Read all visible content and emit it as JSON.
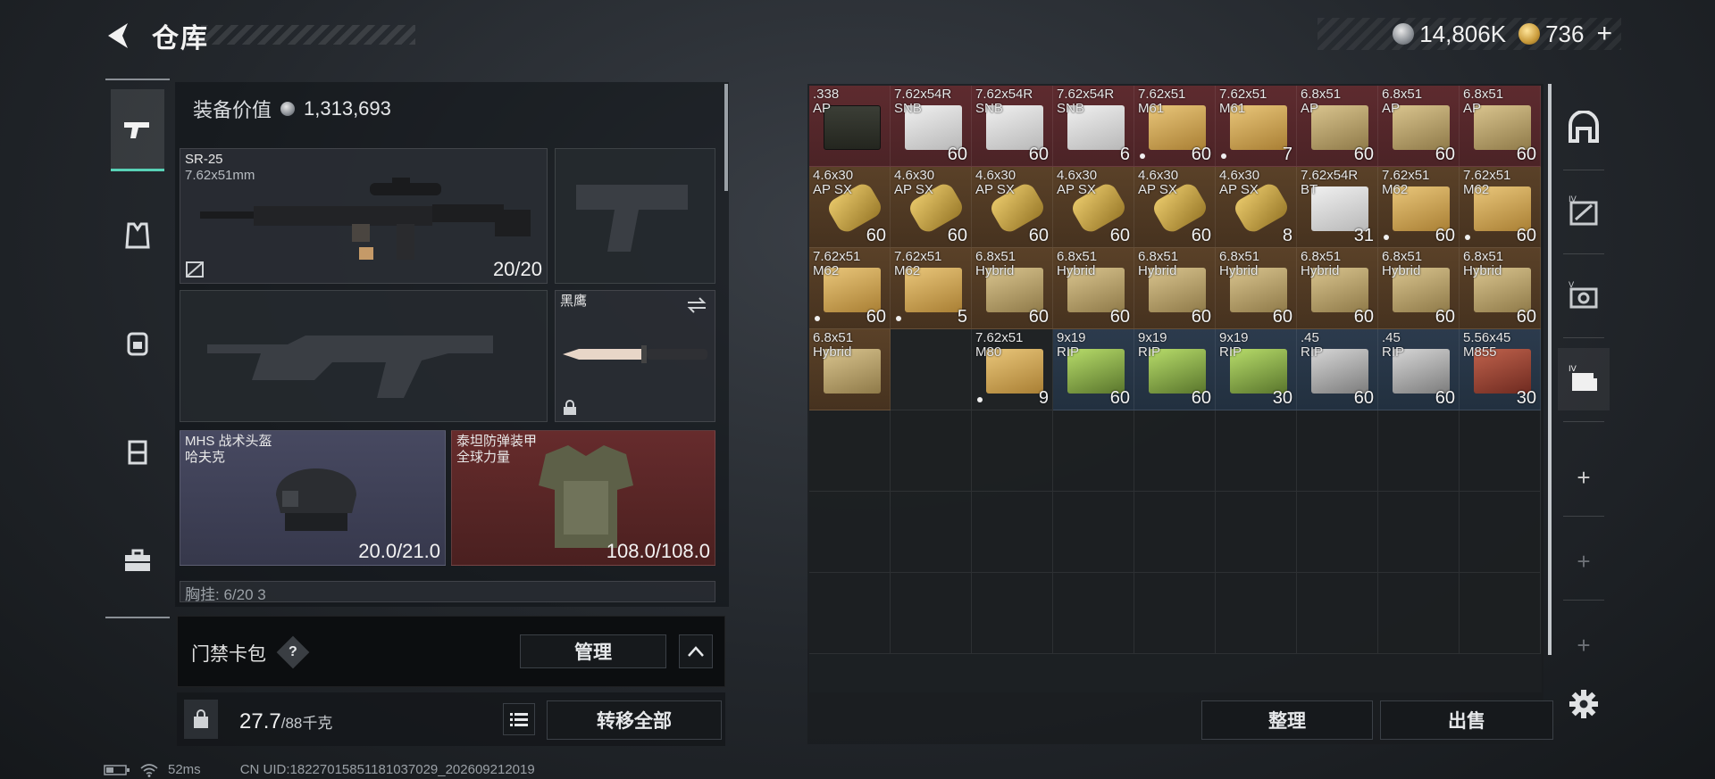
{
  "header": {
    "title": "仓库",
    "currency_silver": "14,806K",
    "currency_gold": "736",
    "add_label": "+"
  },
  "left_nav": {
    "items": [
      "gun-icon",
      "armor-vest-icon",
      "backpack-icon",
      "chest-rig-icon",
      "briefcase-icon"
    ]
  },
  "equipment": {
    "value_label": "装备价值",
    "value": "1,313,693",
    "primary": {
      "name": "SR-25",
      "caliber": "7.62x51mm",
      "count": "20/20"
    },
    "sidearm_knife": {
      "name": "黑鹰"
    },
    "helmet": {
      "name": "MHS 战术头盔",
      "sub": "哈夫克",
      "durability": "20.0/21.0"
    },
    "armor": {
      "name": "泰坦防弹装甲",
      "sub": "全球力量",
      "durability": "108.0/108.0"
    },
    "rig_partial": "胸挂: 6/20  3"
  },
  "keycard": {
    "label": "门禁卡包",
    "help": "?",
    "manage": "管理"
  },
  "weight": {
    "value": "27.7",
    "max": "/88千克"
  },
  "actions": {
    "transfer_all": "转移全部",
    "sort": "整理",
    "sell": "出售"
  },
  "status": {
    "ping": "52ms",
    "uid": "CN UID:18227015851181037029_202609212019"
  },
  "inventory": [
    {
      "name": ".338\nAP",
      "qty": "",
      "bg": "red",
      "box": "ammo-can",
      "dot": false
    },
    {
      "name": "7.62x54R\nSNB",
      "qty": "60",
      "bg": "red",
      "box": "white",
      "dot": false
    },
    {
      "name": "7.62x54R\nSNB",
      "qty": "60",
      "bg": "red",
      "box": "white",
      "dot": false
    },
    {
      "name": "7.62x54R\nSNB",
      "qty": "6",
      "bg": "red",
      "box": "white",
      "dot": false
    },
    {
      "name": "7.62x51\nM61",
      "qty": "60",
      "bg": "red",
      "box": "gold",
      "dot": true
    },
    {
      "name": "7.62x51\nM61",
      "qty": "7",
      "bg": "red",
      "box": "gold",
      "dot": true
    },
    {
      "name": "6.8x51\nAP",
      "qty": "60",
      "bg": "red",
      "box": "tan",
      "dot": false
    },
    {
      "name": "6.8x51\nAP",
      "qty": "60",
      "bg": "red",
      "box": "tan",
      "dot": false
    },
    {
      "name": "6.8x51\nAP",
      "qty": "60",
      "bg": "red",
      "box": "tan",
      "dot": false
    },
    {
      "name": "4.6x30\nAP SX",
      "qty": "60",
      "bg": "brown",
      "box": "bullets",
      "dot": false
    },
    {
      "name": "4.6x30\nAP SX",
      "qty": "60",
      "bg": "brown",
      "box": "bullets",
      "dot": false
    },
    {
      "name": "4.6x30\nAP SX",
      "qty": "60",
      "bg": "brown",
      "box": "bullets",
      "dot": false
    },
    {
      "name": "4.6x30\nAP SX",
      "qty": "60",
      "bg": "brown",
      "box": "bullets",
      "dot": false
    },
    {
      "name": "4.6x30\nAP SX",
      "qty": "60",
      "bg": "brown",
      "box": "bullets",
      "dot": false
    },
    {
      "name": "4.6x30\nAP SX",
      "qty": "8",
      "bg": "brown",
      "box": "bullets",
      "dot": false
    },
    {
      "name": "7.62x54R\nBT",
      "qty": "31",
      "bg": "brown",
      "box": "white",
      "dot": false
    },
    {
      "name": "7.62x51\nM62",
      "qty": "60",
      "bg": "brown",
      "box": "gold",
      "dot": true
    },
    {
      "name": "7.62x51\nM62",
      "qty": "60",
      "bg": "brown",
      "box": "gold",
      "dot": true
    },
    {
      "name": "7.62x51\nM62",
      "qty": "60",
      "bg": "brown",
      "box": "gold",
      "dot": true
    },
    {
      "name": "7.62x51\nM62",
      "qty": "5",
      "bg": "brown",
      "box": "gold",
      "dot": true
    },
    {
      "name": "6.8x51\nHybrid",
      "qty": "60",
      "bg": "brown",
      "box": "tan",
      "dot": false
    },
    {
      "name": "6.8x51\nHybrid",
      "qty": "60",
      "bg": "brown",
      "box": "tan",
      "dot": false
    },
    {
      "name": "6.8x51\nHybrid",
      "qty": "60",
      "bg": "brown",
      "box": "tan",
      "dot": false
    },
    {
      "name": "6.8x51\nHybrid",
      "qty": "60",
      "bg": "brown",
      "box": "tan",
      "dot": false
    },
    {
      "name": "6.8x51\nHybrid",
      "qty": "60",
      "bg": "brown",
      "box": "tan",
      "dot": false
    },
    {
      "name": "6.8x51\nHybrid",
      "qty": "60",
      "bg": "brown",
      "box": "tan",
      "dot": false
    },
    {
      "name": "6.8x51\nHybrid",
      "qty": "60",
      "bg": "brown",
      "box": "tan",
      "dot": false
    },
    {
      "name": "6.8x51\nHybrid",
      "qty": "",
      "bg": "brown",
      "box": "tan",
      "dot": false
    },
    {
      "name": "",
      "qty": "",
      "bg": "dark",
      "box": "",
      "dot": false
    },
    {
      "name": "7.62x51\nM80",
      "qty": "9",
      "bg": "dark",
      "box": "gold",
      "dot": true
    },
    {
      "name": "9x19\nRIP",
      "qty": "60",
      "bg": "blue",
      "box": "green",
      "dot": false
    },
    {
      "name": "9x19\nRIP",
      "qty": "60",
      "bg": "blue",
      "box": "green",
      "dot": false
    },
    {
      "name": "9x19\nRIP",
      "qty": "30",
      "bg": "blue",
      "box": "green",
      "dot": false
    },
    {
      "name": ".45\nRIP",
      "qty": "60",
      "bg": "blue",
      "box": "silver",
      "dot": false
    },
    {
      "name": ".45\nRIP",
      "qty": "60",
      "bg": "blue",
      "box": "silver",
      "dot": false
    },
    {
      "name": "5.56x45\nM855",
      "qty": "30",
      "bg": "blue",
      "box": "redbox",
      "dot": false
    }
  ],
  "right_nav": {
    "plus": "+"
  },
  "colors": {
    "accent": "#58d1b6",
    "rarity_red": "#5e2b2f",
    "rarity_gold": "#5a4128",
    "rarity_blue": "#2c3b4d"
  }
}
